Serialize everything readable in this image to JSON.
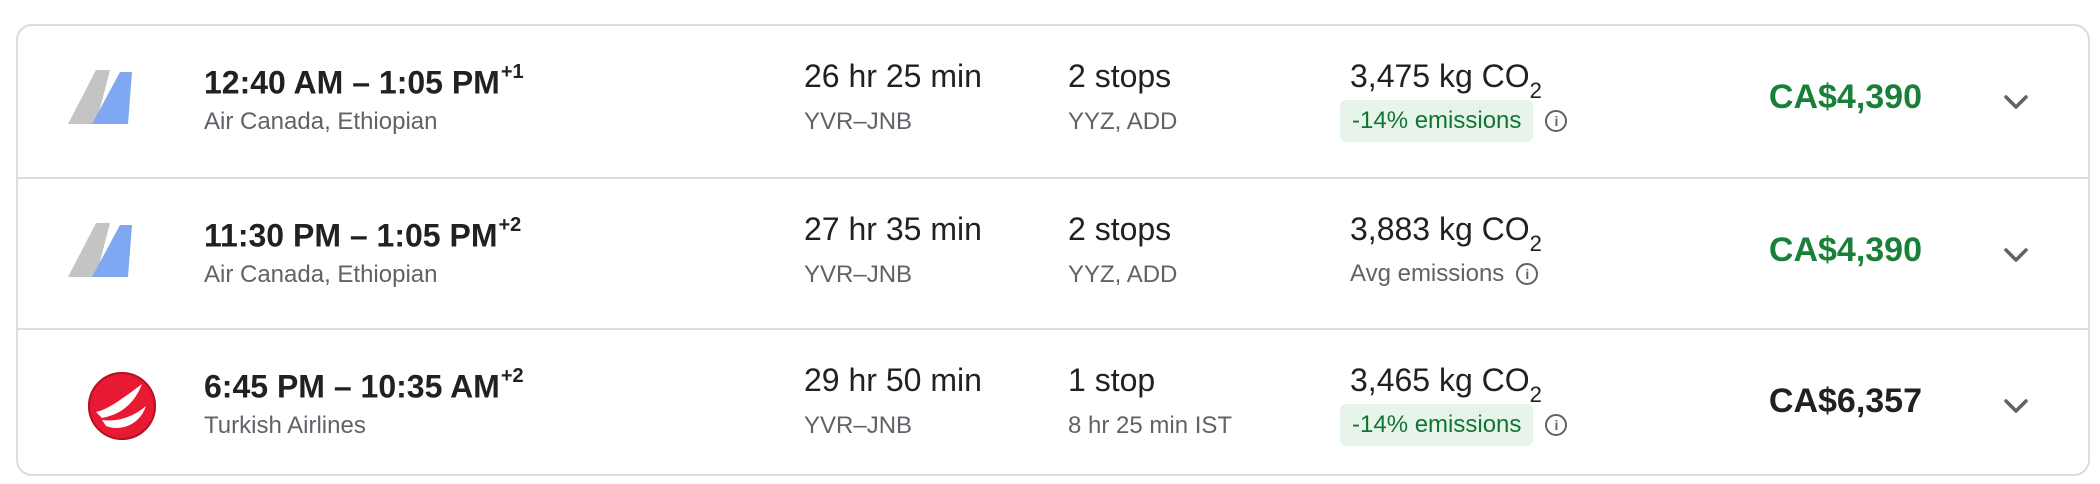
{
  "colors": {
    "price_good": "#188038",
    "price_normal": "#202124",
    "emissions_pill_bg": "#e6f4ea",
    "emissions_pill_text": "#137333"
  },
  "flights": [
    {
      "logo": "air-canada-ethiopian-logo",
      "depart": "12:40 AM",
      "arrive": "1:05 PM",
      "day_offset": "+1",
      "airline": "Air Canada, Ethiopian",
      "duration": "26 hr 25 min",
      "route": "YVR–JNB",
      "stops": "2 stops",
      "stops_detail": "YYZ, ADD",
      "co2_value": "3,475 kg CO",
      "co2_sub": "2",
      "emissions": "-14% emissions",
      "emissions_type": "pill",
      "price": "CA$4,390",
      "price_highlight": true
    },
    {
      "logo": "air-canada-ethiopian-logo",
      "depart": "11:30 PM",
      "arrive": "1:05 PM",
      "day_offset": "+2",
      "airline": "Air Canada, Ethiopian",
      "duration": "27 hr 35 min",
      "route": "YVR–JNB",
      "stops": "2 stops",
      "stops_detail": "YYZ, ADD",
      "co2_value": "3,883 kg CO",
      "co2_sub": "2",
      "emissions": "Avg emissions",
      "emissions_type": "plain",
      "price": "CA$4,390",
      "price_highlight": true
    },
    {
      "logo": "turkish-airlines-logo",
      "depart": "6:45 PM",
      "arrive": "10:35 AM",
      "day_offset": "+2",
      "airline": "Turkish Airlines",
      "duration": "29 hr 50 min",
      "route": "YVR–JNB",
      "stops": "1 stop",
      "stops_detail": "8 hr 25 min IST",
      "co2_value": "3,465 kg CO",
      "co2_sub": "2",
      "emissions": "-14% emissions",
      "emissions_type": "pill",
      "price": "CA$6,357",
      "price_highlight": false
    }
  ]
}
